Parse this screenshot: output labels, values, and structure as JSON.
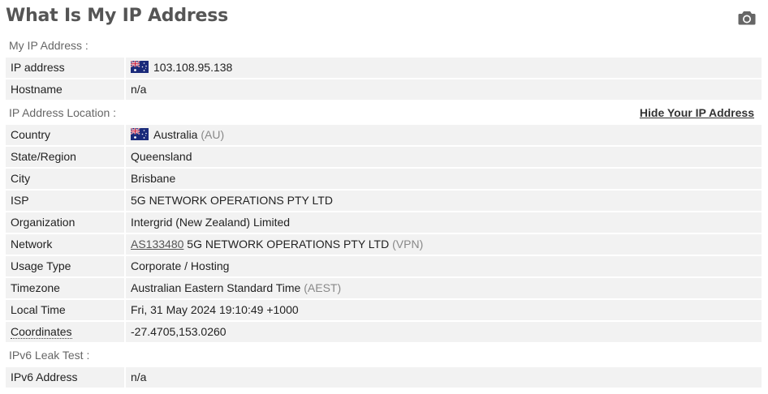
{
  "header": {
    "title": "What Is My IP Address",
    "camera_icon": "camera-icon"
  },
  "sections": {
    "my_ip": "My IP Address :",
    "location": "IP Address Location :",
    "ipv6": "IPv6 Leak Test :",
    "hide_link": "Hide Your IP Address"
  },
  "ip": {
    "ip_label": "IP address",
    "ip_value": "103.108.95.138",
    "hostname_label": "Hostname",
    "hostname_value": "n/a",
    "flag_icon": "australia-flag-icon"
  },
  "location": {
    "country_label": "Country",
    "country_name": "Australia",
    "country_code": "(AU)",
    "state_label": "State/Region",
    "state_value": "Queensland",
    "city_label": "City",
    "city_value": "Brisbane",
    "isp_label": "ISP",
    "isp_value": "5G NETWORK OPERATIONS PTY LTD",
    "org_label": "Organization",
    "org_value": "Intergrid (New Zealand) Limited",
    "network_label": "Network",
    "network_asn": "AS133480",
    "network_name": "5G NETWORK OPERATIONS PTY LTD",
    "network_tag": "(VPN)",
    "usage_label": "Usage Type",
    "usage_value": "Corporate / Hosting",
    "tz_label": "Timezone",
    "tz_value": "Australian Eastern Standard Time",
    "tz_abbr": "(AEST)",
    "time_label": "Local Time",
    "time_value": "Fri, 31 May 2024 19:10:49 +1000",
    "coords_label": "Coordinates",
    "coords_value": "-27.4705,153.0260"
  },
  "ipv6": {
    "label": "IPv6 Address",
    "value": "n/a"
  },
  "colors": {
    "row_bg": "#f2f2f2",
    "title": "#555555",
    "section_text": "#666666",
    "muted": "#888888"
  }
}
